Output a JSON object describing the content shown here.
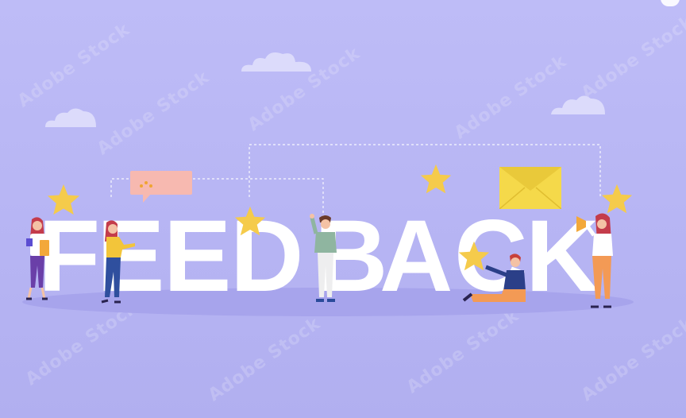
{
  "headline": {
    "letters": [
      "F",
      "E",
      "E",
      "D",
      "B",
      "A",
      "C",
      "K"
    ]
  },
  "watermark": {
    "text": "Adobe Stock"
  },
  "colors": {
    "background": "#b9b7f4",
    "letters": "#ffffff",
    "star": "#f5cb4b",
    "envelope": "#f5d94a",
    "speech_bubble": "#f7b9b0",
    "speech_dots": "#f0a431",
    "floor_shadow": "#a7a4ec"
  },
  "icons": [
    "star-icon",
    "envelope-icon",
    "speech-bubble-icon",
    "megaphone-icon",
    "cloud-icon"
  ]
}
